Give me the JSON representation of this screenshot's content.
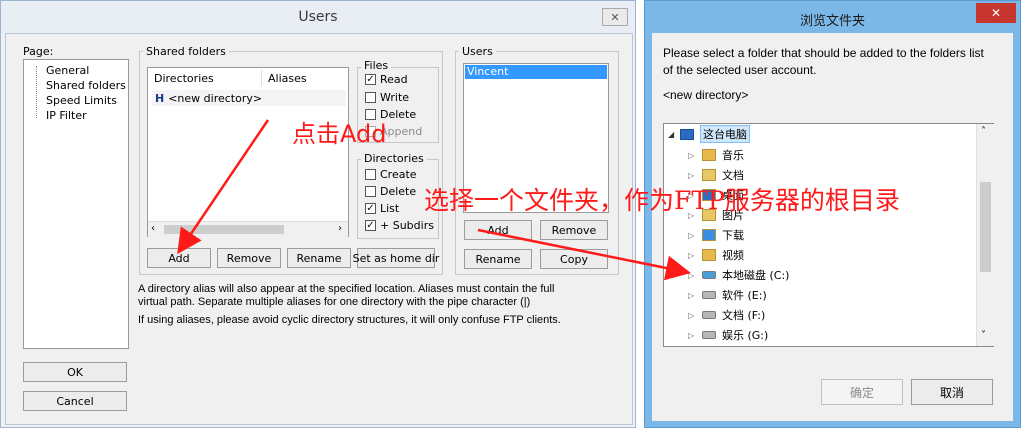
{
  "users_dialog": {
    "title": "Users",
    "page_label": "Page:",
    "pages": [
      "General",
      "Shared folders",
      "Speed Limits",
      "IP Filter"
    ],
    "shared_folders_label": "Shared folders",
    "col_directories": "Directories",
    "col_aliases": "Aliases",
    "directory_entry": "<new directory>",
    "files_label": "Files",
    "files": [
      {
        "label": "Read",
        "checked": true
      },
      {
        "label": "Write",
        "checked": false
      },
      {
        "label": "Delete",
        "checked": false
      },
      {
        "label": "Append",
        "checked": false
      }
    ],
    "directories_label": "Directories",
    "dirs": [
      {
        "label": "Create",
        "checked": false
      },
      {
        "label": "Delete",
        "checked": false
      },
      {
        "label": "List",
        "checked": true
      },
      {
        "label": "+ Subdirs",
        "checked": true
      }
    ],
    "buttons": {
      "add": "Add",
      "remove": "Remove",
      "rename": "Rename",
      "set_home": "Set as home dir"
    },
    "users_label": "Users",
    "users": [
      "Vincent"
    ],
    "user_buttons": {
      "add": "Add",
      "remove": "Remove",
      "rename": "Rename",
      "copy": "Copy"
    },
    "info1": "A directory alias will also appear at the specified location. Aliases must contain the full virtual path. Separate multiple aliases for one directory with the pipe character (|)",
    "info2": "If using aliases, please avoid cyclic directory structures, it will only confuse FTP clients.",
    "ok": "OK",
    "cancel": "Cancel"
  },
  "browse_dialog": {
    "title": "浏览文件夹",
    "prompt": "Please select a folder that should be added to the folders list of the selected user account.",
    "selection": "<new directory>",
    "root": "这台电脑",
    "items": [
      {
        "label": "音乐",
        "icon": "music-folder-icon"
      },
      {
        "label": "文档",
        "icon": "documents-folder-icon"
      },
      {
        "label": "桌面",
        "icon": "desktop-folder-icon"
      },
      {
        "label": "图片",
        "icon": "pictures-folder-icon"
      },
      {
        "label": "下载",
        "icon": "downloads-folder-icon"
      },
      {
        "label": "视频",
        "icon": "videos-folder-icon"
      },
      {
        "label": "本地磁盘 (C:)",
        "icon": "system-drive-icon"
      },
      {
        "label": "软件 (E:)",
        "icon": "drive-icon"
      },
      {
        "label": "文档 (F:)",
        "icon": "drive-icon"
      },
      {
        "label": "娱乐 (G:)",
        "icon": "drive-icon"
      }
    ],
    "ok": "确定",
    "cancel": "取消"
  },
  "annotations": {
    "click_add": "点击Add",
    "choose_folder": "选择一个文件夹，作为FTP服务器的根目录",
    "color": "#ff1a1a"
  }
}
